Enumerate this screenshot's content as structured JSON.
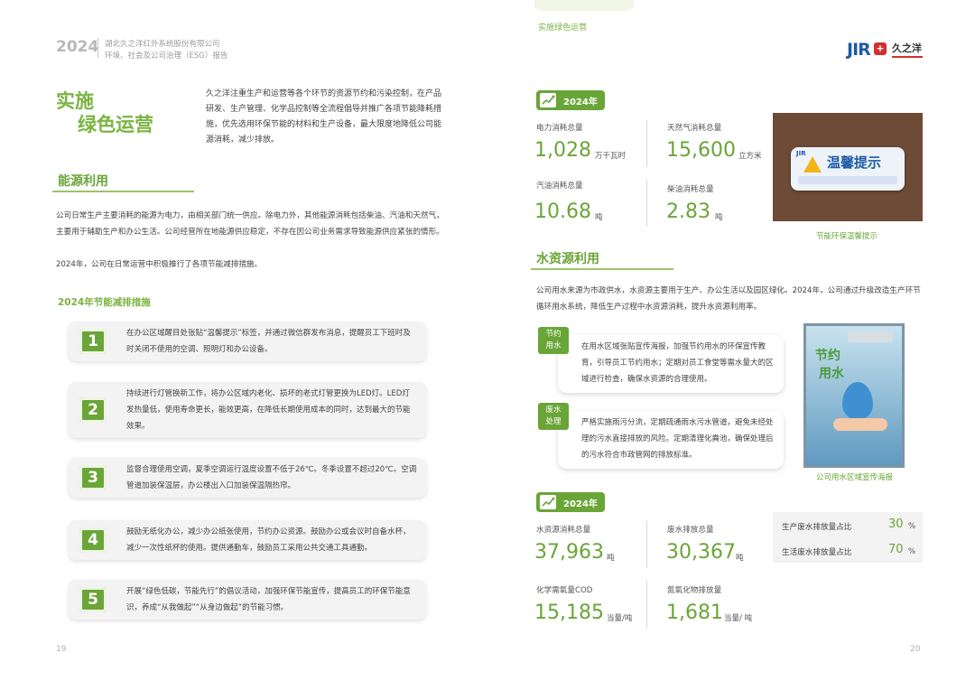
{
  "left": {
    "header": {
      "year": "2024",
      "company": "湖北久之洋红外系统股份有限公司",
      "report": "环境、社会及公司治理（ESG）报告"
    },
    "title_line1": "实施",
    "title_line2": "绿色运营",
    "intro": "久之洋注重生产和运营等各个环节的资源节约和污染控制，在产品研发、生产管理、化学品控制等全流程倡导并推广各项节能降耗措施，优先选用环保节能的材料和生产设备，最大限度地降低公司能源消耗，减少排放。",
    "energy_section": {
      "title": "能源利用",
      "para1": "公司日常生产主要消耗的能源为电力，由相关部门统一供应。除电力外，其他能源消耗包括柴油、汽油和天然气，主要用于辅助生产和办公生活。公司经营所在地能源供应稳定，不存在因公司业务需求导致能源供应紧张的情形。",
      "para2": "2024年，公司在日常运营中积极推行了各项节能减排措施。",
      "subtitle": "2024年节能减排措施",
      "steps": [
        {
          "num": "1",
          "text": "在办公区域醒目处张贴“温馨提示”标签，并通过微信群发布消息，提醒员工下班时及时关闭不使用的空调、照明灯和办公设备。"
        },
        {
          "num": "2",
          "text": "持续进行灯管换新工作，将办公区域内老化、损坏的老式灯管更换为LED灯。LED灯发热量低，使用寿命更长，能效更高，在降低长期使用成本的同时，达到最大的节能效果。"
        },
        {
          "num": "3",
          "text": "监督合理使用空调，夏季空调运行温度设置不低于26℃。冬季设置不超过20℃。空调管道加装保温层，办公楼出入口加装保温隔热帘。"
        },
        {
          "num": "4",
          "text": "鼓励无纸化办公，减少办公纸张使用，节约办公资源。鼓励办公或会议时自备水杯，减少一次性纸杯的使用。提供通勤车，鼓励员工采用公共交通工具通勤。"
        },
        {
          "num": "5",
          "text": "开展“绿色低碳，节能先行”的倡议活动，加强环保节能宣传，提高员工的环保节能意识，养成“从我做起”“从身边做起”的节能习惯。"
        }
      ]
    },
    "page_number": "19"
  },
  "right": {
    "header_title": "实施绿色运营",
    "logo": {
      "mark": "JIR",
      "name": "久之洋"
    },
    "energy_badge": "2024年",
    "energy_metrics": [
      {
        "label": "电力消耗总量",
        "value": "1,028",
        "unit": "万千瓦时"
      },
      {
        "label": "天然气消耗总量",
        "value": "15,600",
        "unit": "立方米"
      },
      {
        "label": "汽油消耗总量",
        "value": "10.68",
        "unit": "吨"
      },
      {
        "label": "柴油消耗总量",
        "value": "2.83",
        "unit": "吨"
      }
    ],
    "photo_sign": {
      "title": "温馨提示",
      "small": "JIR"
    },
    "photo_caption": "节能环保温馨提示",
    "water_section": {
      "title": "水资源利用",
      "para": "公司用水来源为市政供水，水资源主要用于生产、办公生活以及园区绿化。2024年，公司通过升级改造生产环节循环用水系统，降低生产过程中水资源消耗，提升水资源利用率。",
      "cards": [
        {
          "tag_line1": "节约",
          "tag_line2": "用水",
          "text": "在用水区域张贴宣传海报，加强节约用水的环保宣传教育，引导员工节约用水；定期对员工食堂等需水量大的区域进行检查，确保水资源的合理使用。"
        },
        {
          "tag_line1": "废水",
          "tag_line2": "处理",
          "text": "严格实施雨污分流，定期疏通雨水污水管道，避免未经处理的污水直接排放的风险。定期清理化粪池，确保处理后的污水符合市政管网的排放标准。"
        }
      ],
      "poster": {
        "line1": "节约",
        "line2": "用水"
      },
      "poster_caption": "公司用水区域宣传海报"
    },
    "water_badge": "2024年",
    "water_metrics": [
      {
        "label": "水资源消耗总量",
        "value": "37,963",
        "unit": "吨"
      },
      {
        "label": "废水排放总量",
        "value": "30,367",
        "unit": "吨"
      },
      {
        "label": "化学需氧量COD",
        "value": "15,185",
        "unit": "当量/吨"
      },
      {
        "label": "氮氧化物排放量",
        "value": "1,681",
        "unit": "当量/ 吨"
      }
    ],
    "ratios": [
      {
        "label": "生产废水排放量占比",
        "value": "30",
        "unit": "%"
      },
      {
        "label": "生活废水排放量占比",
        "value": "70",
        "unit": "%"
      }
    ],
    "page_number": "20"
  }
}
